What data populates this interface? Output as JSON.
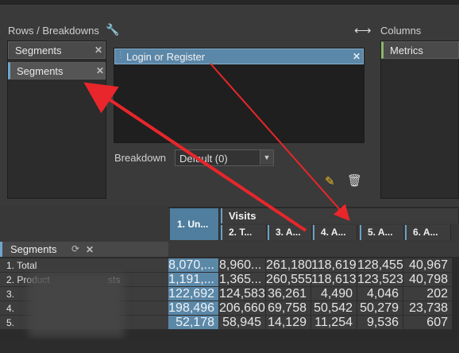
{
  "left_panel": {
    "title": "Rows / Breakdowns",
    "header_chip": "Segments",
    "item": "Segments"
  },
  "center_panel": {
    "item": "Login or Register",
    "breakdown_label": "Breakdown",
    "breakdown_value": "Default (0)"
  },
  "right_panel": {
    "title": "Columns",
    "item": "Metrics"
  },
  "grid": {
    "group_header": "Visits",
    "columns": [
      "1. Un...",
      "2. T...",
      "3. A...",
      "4. A...",
      "5. A...",
      "6. A..."
    ],
    "row_header": "Segments",
    "rows": [
      {
        "label": "1.  Total",
        "values": [
          "8,070,...",
          "8,960...",
          "261,180",
          "118,619",
          "128,455",
          "40,967"
        ]
      },
      {
        "label": "2.  Product",
        "label_suffix": "sts",
        "values": [
          "1,191,...",
          "1,365...",
          "260,555",
          "118,613",
          "123,523",
          "40,798"
        ]
      },
      {
        "label": "3.",
        "values": [
          "122,692",
          "124,583",
          "36,261",
          "4,490",
          "4,046",
          "202"
        ]
      },
      {
        "label": "4.",
        "values": [
          "198,496",
          "206,660",
          "69,758",
          "50,542",
          "50,279",
          "23,738"
        ]
      },
      {
        "label": "5.",
        "values": [
          "52,178",
          "58,945",
          "14,129",
          "11,254",
          "9,536",
          "607"
        ]
      }
    ]
  },
  "colors": {
    "accent": "#5c88a8",
    "arrow": "#e8262b"
  }
}
